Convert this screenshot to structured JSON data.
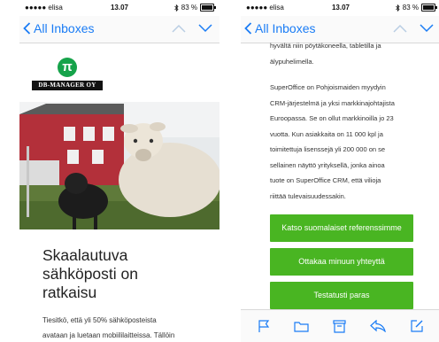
{
  "left_phone": {
    "status": {
      "carrier": "●●●●● elisa",
      "time": "13.07",
      "battery": "83 %",
      "battery_level": 0.83
    },
    "nav": {
      "back_label": "All Inboxes"
    },
    "logo": {
      "symbol": "π",
      "company": "DB-MANAGER OY"
    },
    "headline": [
      "Skaalautuva",
      "sähköposti on",
      "ratkaisu"
    ],
    "body": [
      "Tiesitkö, että yli 50% sähköposteista",
      "avataan ja luetaan mobiililaitteissa. Tällöin"
    ]
  },
  "right_phone": {
    "status": {
      "carrier": "●●●●● elisa",
      "time": "13.07",
      "battery": "83 %",
      "battery_level": 0.83
    },
    "nav": {
      "back_label": "All Inboxes"
    },
    "para1_lines": [
      "hyvältä niin pöytäkoneella, tabletilla ja",
      "älypuhelimella."
    ],
    "para2_lines": [
      "SuperOffice on Pohjoismaiden myydyin",
      "CRM-järjestelmä ja yksi markkinajohtajista",
      "Euroopassa. Se on ollut markkinoilla jo 23",
      "vuotta. Kun asiakkaita on 11 000 kpl ja",
      "toimitettuja lisenssejä yli 200 000 on se",
      "sellainen näyttö yrityksellä, jonka ainoa",
      "tuote on SuperOffice CRM, että vilioja",
      "riittää tulevaisuudessakin."
    ],
    "buttons": [
      "Katso suomalaiset referenssimme",
      "Ottakaa minuun yhteyttä",
      "Testatusti paras"
    ],
    "toolbar_icons": [
      "flag-icon",
      "folder-icon",
      "archive-icon",
      "reply-icon",
      "compose-icon"
    ]
  },
  "colors": {
    "accent": "#1a7cf5",
    "button": "#49b522",
    "logo": "#16a34a"
  }
}
